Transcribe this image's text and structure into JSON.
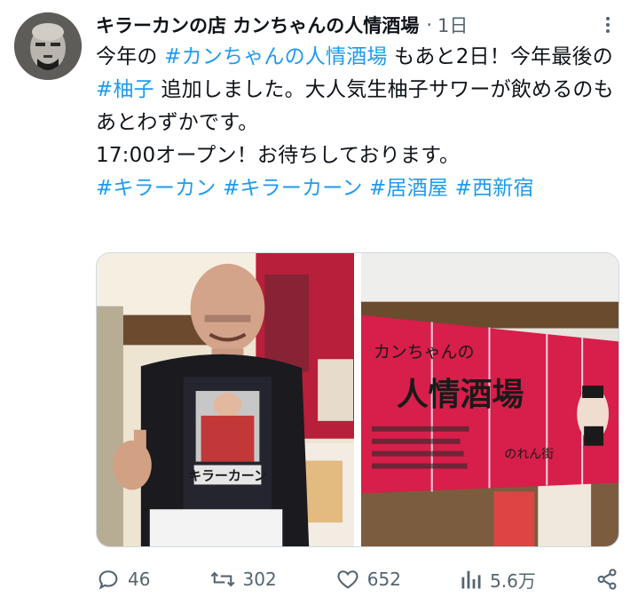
{
  "author": {
    "display_name": "キラーカンの店 カンちゃんの人情酒場",
    "timestamp": "1日",
    "separator": "·"
  },
  "tweet": {
    "seg1": "今年の",
    "tag1": "#カンちゃんの人情酒場",
    "seg2": "もあと2日！今年最後の",
    "tag2": "#柚子",
    "seg3": "追加しました。大人気生柚子サワーが飲めるのもあとわずかです。",
    "line2": "17:00オープン！お待ちしております。",
    "tags": [
      "#キラーカン",
      "#キラーカーン",
      "#居酒屋",
      "#西新宿"
    ]
  },
  "media": {
    "photo1_shirt_text": "キラーカーン",
    "photo2_curtain_title": "人情酒場",
    "photo2_curtain_small": "カンちゃんの",
    "photo2_curtain_right": "のれん街"
  },
  "actions": {
    "replies": "46",
    "retweets": "302",
    "likes": "652",
    "views": "5.6万"
  },
  "colors": {
    "accent": "#1d9bf0",
    "muted": "#536471",
    "text": "#0f1419"
  }
}
